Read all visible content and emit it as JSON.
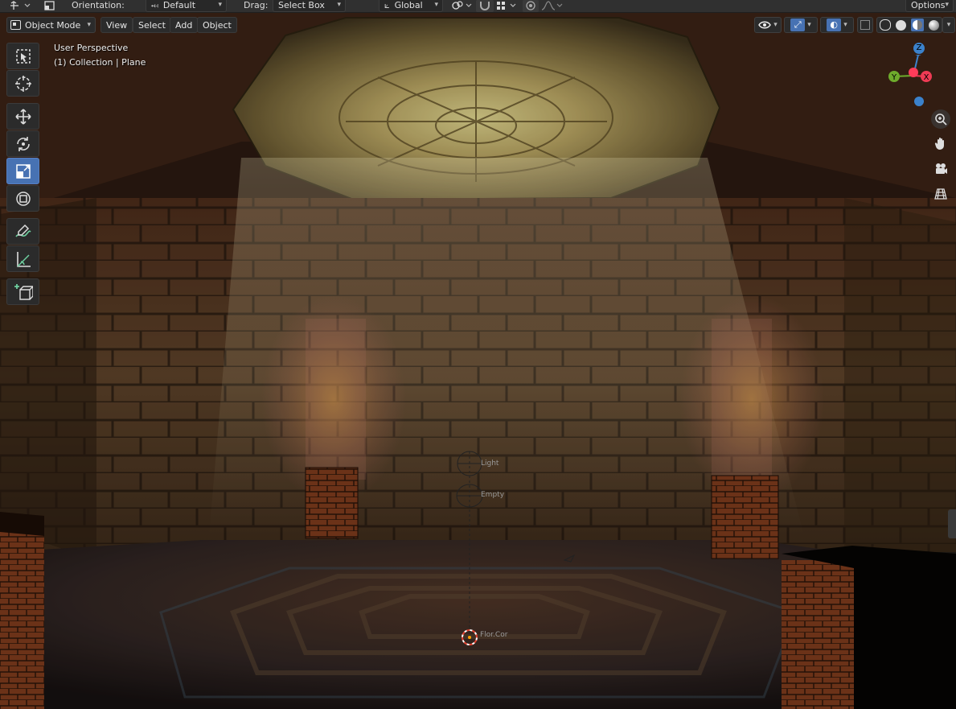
{
  "header": {
    "orientation_label": "Orientation:",
    "orientation_value": "Default",
    "drag_label": "Drag:",
    "drag_value": "Select Box",
    "transform_space": "Global",
    "options_label": "Options"
  },
  "menu": {
    "mode": "Object Mode",
    "items": [
      "View",
      "Select",
      "Add",
      "Object"
    ]
  },
  "viewport": {
    "perspective": "User Perspective",
    "context": "(1) Collection | Plane",
    "cursor_label": "Flor.Cor",
    "light_label": "Light",
    "empty_label": "Empty"
  },
  "gizmo": {
    "z": "Z",
    "y": "Y",
    "x": "X",
    "colors": {
      "x": "#ee3b54",
      "y": "#6eab2c",
      "z": "#3b82cc"
    }
  },
  "toolbar": {
    "tools": [
      "select-box-icon",
      "cursor-icon",
      "move-icon",
      "rotate-icon",
      "scale-icon",
      "transform-icon",
      "annotate-icon",
      "measure-icon",
      "add-cube-icon"
    ],
    "active": "scale-icon"
  },
  "nav": [
    "zoom-icon",
    "hand-pan-icon",
    "camera-icon",
    "perspective-grid-icon"
  ],
  "colors": {
    "header_bg": "#303030",
    "accent": "#4772b3"
  }
}
